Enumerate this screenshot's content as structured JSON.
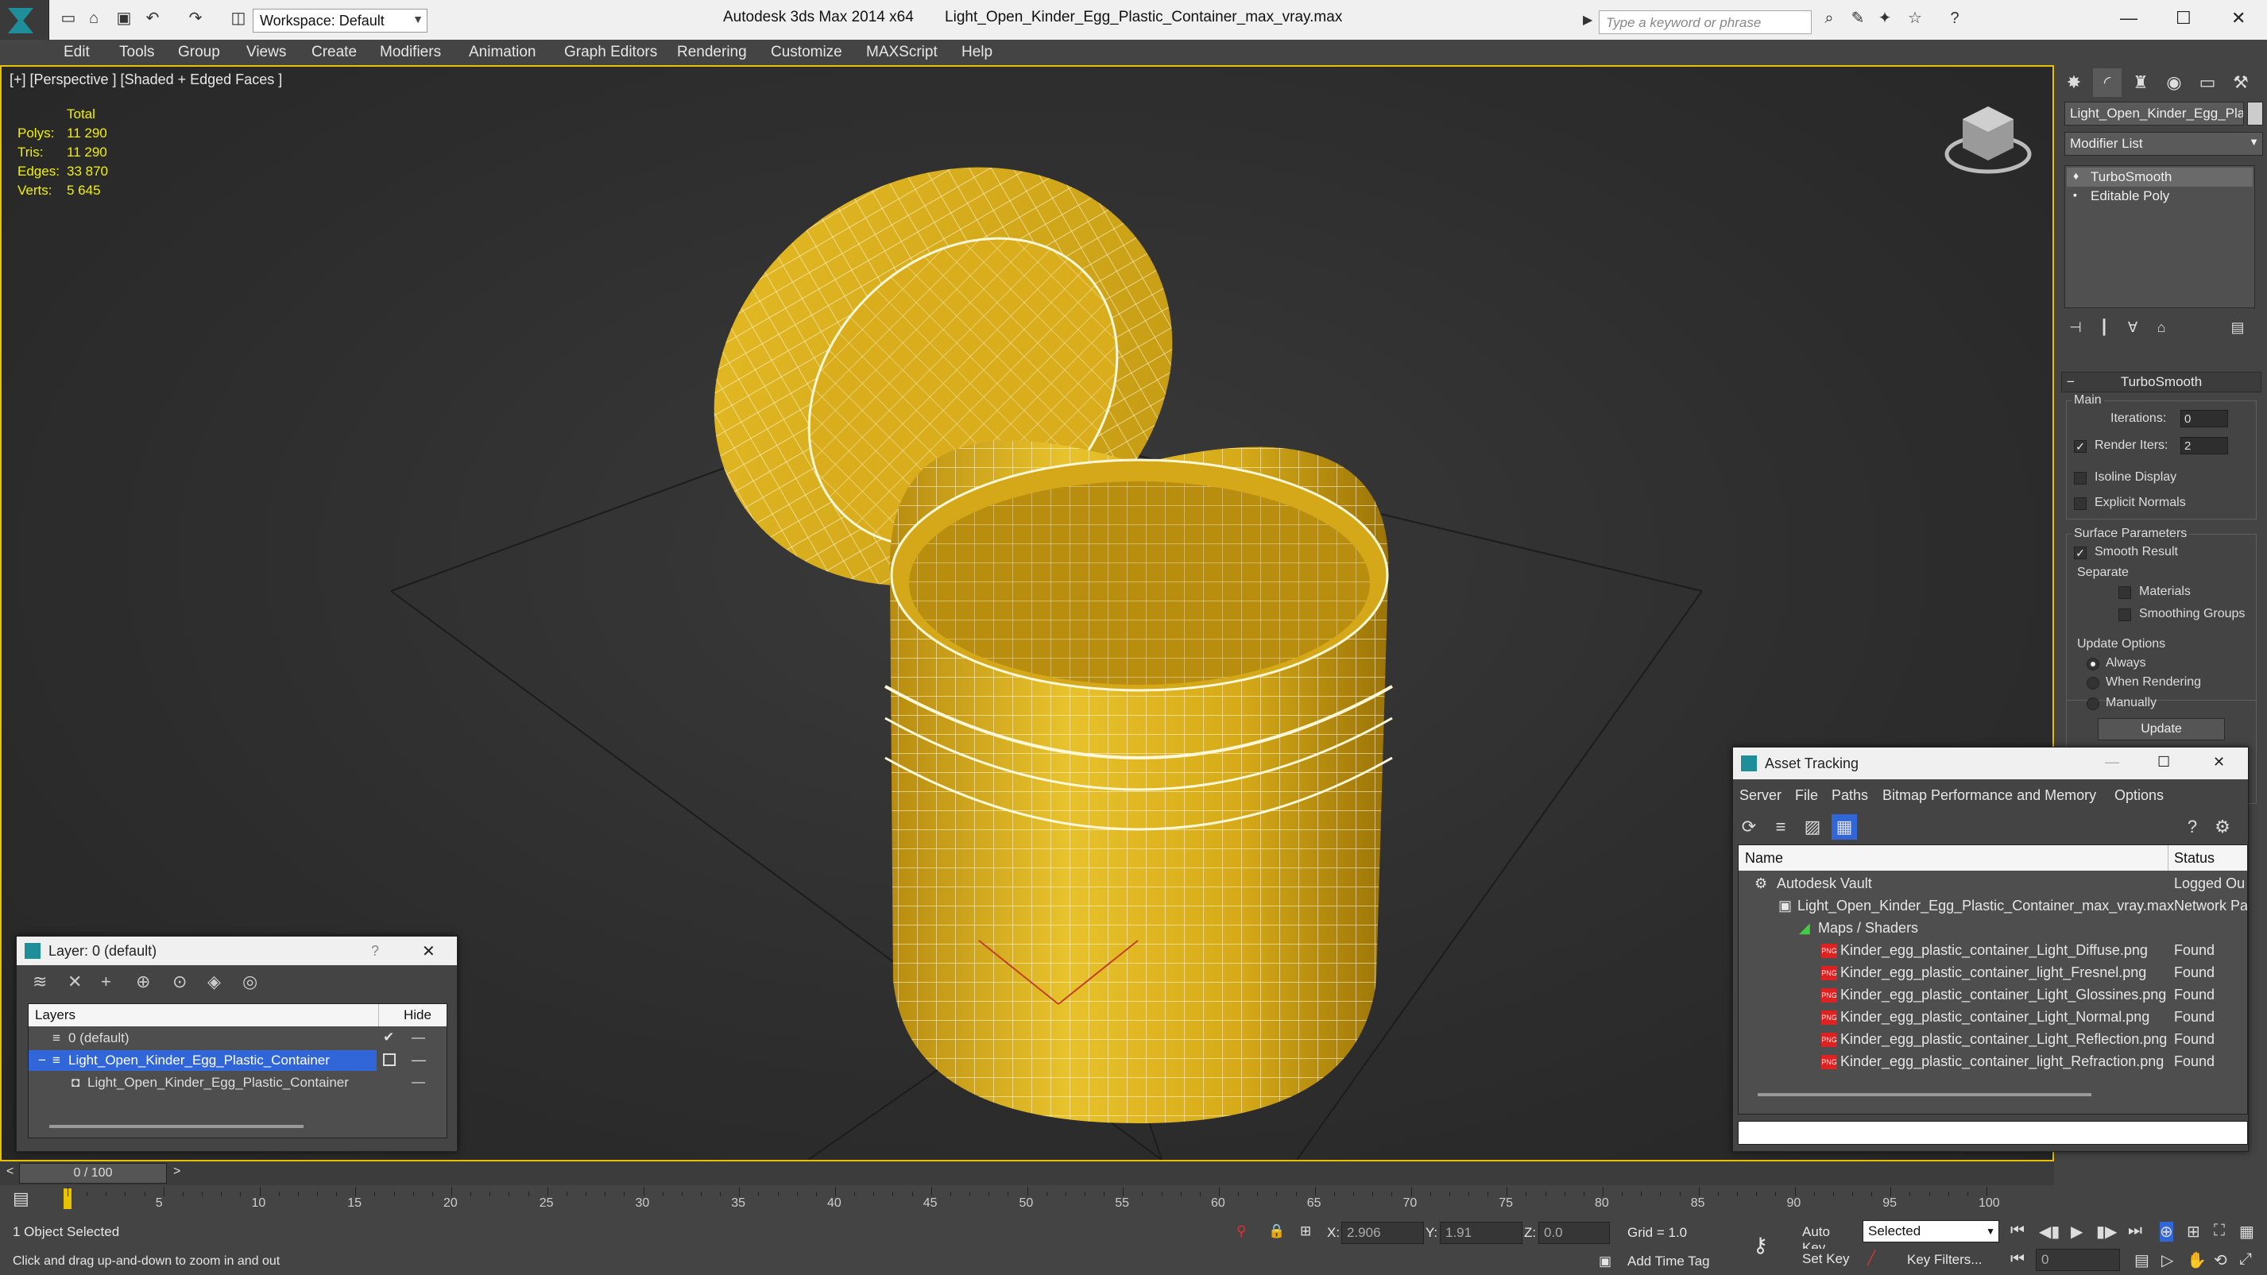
{
  "titlebar": {
    "workspace": "Workspace: Default",
    "app_name": "Autodesk 3ds Max  2014 x64",
    "file_name": "Light_Open_Kinder_Egg_Plastic_Container_max_vray.max",
    "search_placeholder": "Type a keyword or phrase"
  },
  "menu": [
    "Edit",
    "Tools",
    "Group",
    "Views",
    "Create",
    "Modifiers",
    "Animation",
    "Graph Editors",
    "Rendering",
    "Customize",
    "MAXScript",
    "Help"
  ],
  "viewport": {
    "label": "[+] [Perspective ] [Shaded + Edged Faces ]",
    "stats_header": "Total",
    "stats": [
      {
        "label": "Polys:",
        "value": "11 290"
      },
      {
        "label": "Tris:",
        "value": "11 290"
      },
      {
        "label": "Edges:",
        "value": "33 870"
      },
      {
        "label": "Verts:",
        "value": "5 645"
      }
    ],
    "mesh_color": "#e2b520",
    "wire_color": "#fff8d8"
  },
  "command_panel": {
    "object_name": "Light_Open_Kinder_Egg_Plas",
    "modifier_list": "Modifier List",
    "stack": [
      "TurboSmooth",
      "Editable Poly"
    ],
    "rollout_title": "TurboSmooth",
    "main_group": "Main",
    "iterations_label": "Iterations:",
    "iterations_value": "0",
    "render_iters_label": "Render Iters:",
    "render_iters_value": "2",
    "isoline": "Isoline Display",
    "explicit_normals": "Explicit Normals",
    "surface_params": "Surface Parameters",
    "smooth_result": "Smooth Result",
    "separate": "Separate",
    "materials": "Materials",
    "smoothing_groups": "Smoothing Groups",
    "update_options": "Update Options",
    "always": "Always",
    "when_rendering": "When Rendering",
    "manually": "Manually",
    "update_button": "Update"
  },
  "layer_window": {
    "title": "Layer: 0 (default)",
    "help": "?",
    "col_layers": "Layers",
    "col_hide": "Hide",
    "rows": [
      {
        "name": "0 (default)"
      },
      {
        "name": "Light_Open_Kinder_Egg_Plastic_Container"
      },
      {
        "name": "Light_Open_Kinder_Egg_Plastic_Container"
      }
    ]
  },
  "asset_window": {
    "title": "Asset Tracking",
    "menu": [
      "Server",
      "File",
      "Paths",
      "Bitmap Performance and Memory",
      "Options"
    ],
    "col_name": "Name",
    "col_status": "Status",
    "rows": [
      {
        "name": "Autodesk Vault",
        "status": "Logged Ou"
      },
      {
        "name": "Light_Open_Kinder_Egg_Plastic_Container_max_vray.max",
        "status": "Network Pa"
      },
      {
        "name": "Maps / Shaders",
        "status": ""
      },
      {
        "name": "Kinder_egg_plastic_container_Light_Diffuse.png",
        "status": "Found"
      },
      {
        "name": "Kinder_egg_plastic_container_light_Fresnel.png",
        "status": "Found"
      },
      {
        "name": "Kinder_egg_plastic_container_Light_Glossines.png",
        "status": "Found"
      },
      {
        "name": "Kinder_egg_plastic_container_Light_Normal.png",
        "status": "Found"
      },
      {
        "name": "Kinder_egg_plastic_container_Light_Reflection.png",
        "status": "Found"
      },
      {
        "name": "Kinder_egg_plastic_container_light_Refraction.png",
        "status": "Found"
      }
    ]
  },
  "timeline": {
    "frame_display": "0 / 100",
    "ticks": [
      "5",
      "10",
      "15",
      "20",
      "25",
      "30",
      "35",
      "40",
      "45",
      "50",
      "55",
      "60",
      "65",
      "70",
      "75",
      "80",
      "85",
      "90",
      "95",
      "100"
    ]
  },
  "status": {
    "selection": "1 Object Selected",
    "prompt": "Click and drag up-and-down to zoom in and out",
    "x_label": "X:",
    "x_value": "2.906",
    "y_label": "Y:",
    "y_value": "1.91",
    "z_label": "Z:",
    "z_value": "0.0",
    "grid": "Grid = 1.0",
    "add_time_tag": "Add Time Tag",
    "auto_key": "Auto Key",
    "set_key": "Set Key",
    "selected_dropdown": "Selected",
    "key_filters": "Key Filters...",
    "frame_value": "0"
  }
}
